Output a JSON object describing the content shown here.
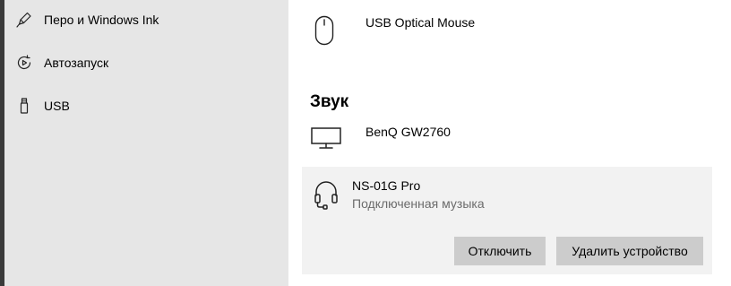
{
  "sidebar": {
    "items": [
      {
        "label": "Перо и Windows Ink",
        "icon": "pen-icon"
      },
      {
        "label": "Автозапуск",
        "icon": "autoplay-icon"
      },
      {
        "label": "USB",
        "icon": "usb-icon"
      }
    ]
  },
  "devices": {
    "mouse": {
      "name": "USB Optical Mouse",
      "icon": "mouse-icon"
    }
  },
  "sound": {
    "title": "Звук",
    "monitor": {
      "name": "BenQ GW2760",
      "icon": "monitor-icon"
    },
    "headphones": {
      "name": "NS-01G Pro",
      "status": "Подключенная музыка",
      "icon": "headphones-icon",
      "disconnect_label": "Отключить",
      "remove_label": "Удалить устройство"
    }
  },
  "colors": {
    "sidebar_bg": "#e6e6e6",
    "selected_bg": "#f2f2f2",
    "button_bg": "#cccccc",
    "secondary_text": "#6b6b6b"
  }
}
